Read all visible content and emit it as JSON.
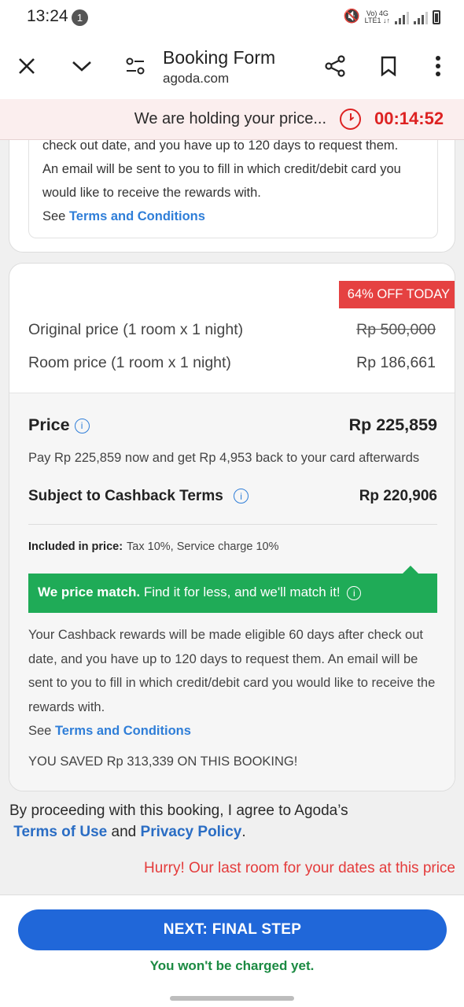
{
  "status_bar": {
    "time": "13:24",
    "notification_count": "1",
    "network_top": "Vo) 4G",
    "network_bottom": "LTE1 ↓↑"
  },
  "toolbar": {
    "title": "Booking Form",
    "subtitle": "agoda.com"
  },
  "hold_banner": {
    "message": "We are holding your price...",
    "timer": "00:14:52"
  },
  "top_card": {
    "line1": "check out date, and you have up to 120 days to request them.",
    "line2": "An email will be sent to you to fill in which credit/debit card you",
    "line3": "would like to receive the rewards with.",
    "see": "See",
    "terms_link": "Terms and Conditions"
  },
  "price_card": {
    "discount_badge": "64% OFF TODAY",
    "original_label": "Original price (1 room x 1 night)",
    "original_value": "Rp 500,000",
    "room_label": "Room price (1 room x 1 night)",
    "room_value": "Rp 186,661",
    "price_label": "Price",
    "price_value": "Rp 225,859",
    "pay_note": "Pay Rp 225,859 now and get Rp 4,953 back to your card afterwards",
    "cashback_label": "Subject to Cashback Terms",
    "cashback_value": "Rp 220,906",
    "included_label": "Included in price:",
    "included_value": "Tax 10%, Service charge 10%",
    "price_match_bold": "We price match.",
    "price_match_text": "Find it for less, and we'll match it!",
    "cashback_text": "Your Cashback rewards will be made eligible 60 days after check out date, and you have up to 120 days to request them. An email will be sent to you to fill in which credit/debit card you would like to receive the rewards with.",
    "see": "See",
    "terms_link": "Terms and Conditions",
    "saved": "YOU SAVED Rp 313,339 ON THIS BOOKING!"
  },
  "agreement": {
    "text": "By proceeding with this booking, I agree to Agoda’s",
    "terms_of_use": "Terms of Use",
    "and": "and",
    "privacy_policy": "Privacy Policy",
    "period": "."
  },
  "hurry": "Hurry! Our last room for your dates at this price",
  "footer": {
    "next_button": "NEXT: FINAL STEP",
    "charged_note": "You won't be charged yet."
  },
  "colors": {
    "accent_blue": "#2067d9",
    "link_blue": "#2f7ed8",
    "alert_red": "#e43b3b",
    "green": "#1fab57"
  }
}
